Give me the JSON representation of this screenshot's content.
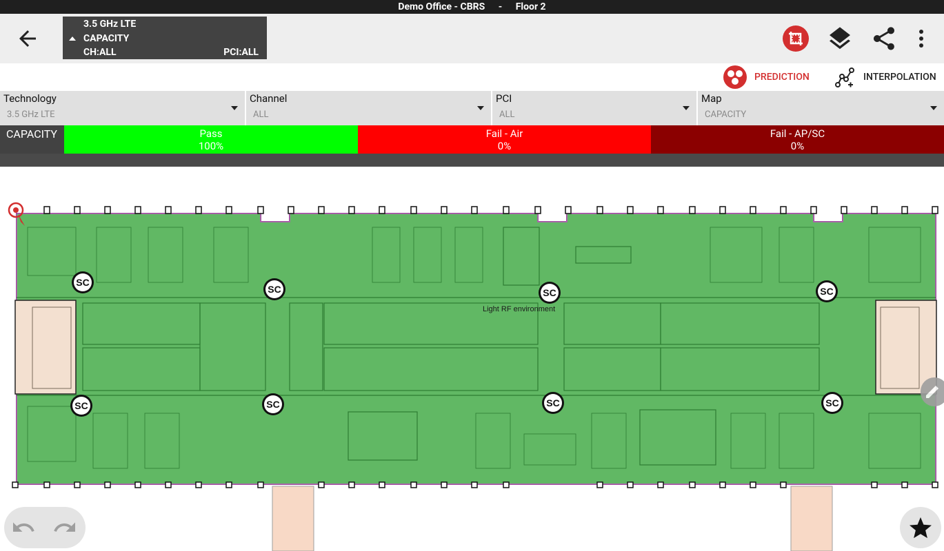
{
  "window": {
    "project": "Demo Office - CBRS",
    "separator": "-",
    "floor": "Floor 2"
  },
  "toolbar": {
    "layer": {
      "technology": "3.5 GHz LTE",
      "map": "CAPACITY",
      "channel": "CH:ALL",
      "pci": "PCI:ALL"
    },
    "icons": [
      "back-arrow-icon",
      "crop-icon",
      "layers-icon",
      "share-icon",
      "more-vert-icon"
    ]
  },
  "modes": {
    "prediction": "PREDICTION",
    "interpolation": "INTERPOLATION"
  },
  "filters": [
    {
      "label": "Technology",
      "value": "3.5 GHz LTE"
    },
    {
      "label": "Channel",
      "value": "ALL"
    },
    {
      "label": "PCI",
      "value": "ALL"
    },
    {
      "label": "Map",
      "value": "CAPACITY"
    }
  ],
  "legend": {
    "title": "CAPACITY",
    "segments": [
      {
        "label": "Pass",
        "value": "100%",
        "color": "#00ff00"
      },
      {
        "label": "Fail - Air",
        "value": "0%",
        "color": "#ff0000"
      },
      {
        "label": "Fail - AP/SC",
        "value": "0%",
        "color": "#8b0000"
      }
    ]
  },
  "map": {
    "annotation": "Light RF environment",
    "coverage_color": "#4caf50",
    "small_cell_label": "SC",
    "small_cells": [
      "SC",
      "SC",
      "SC",
      "SC",
      "SC",
      "SC",
      "SC",
      "SC"
    ]
  },
  "colors": {
    "accent_red": "#d32f2f",
    "toolbar_bg": "#eeeeee",
    "legend_bg": "#424242"
  }
}
